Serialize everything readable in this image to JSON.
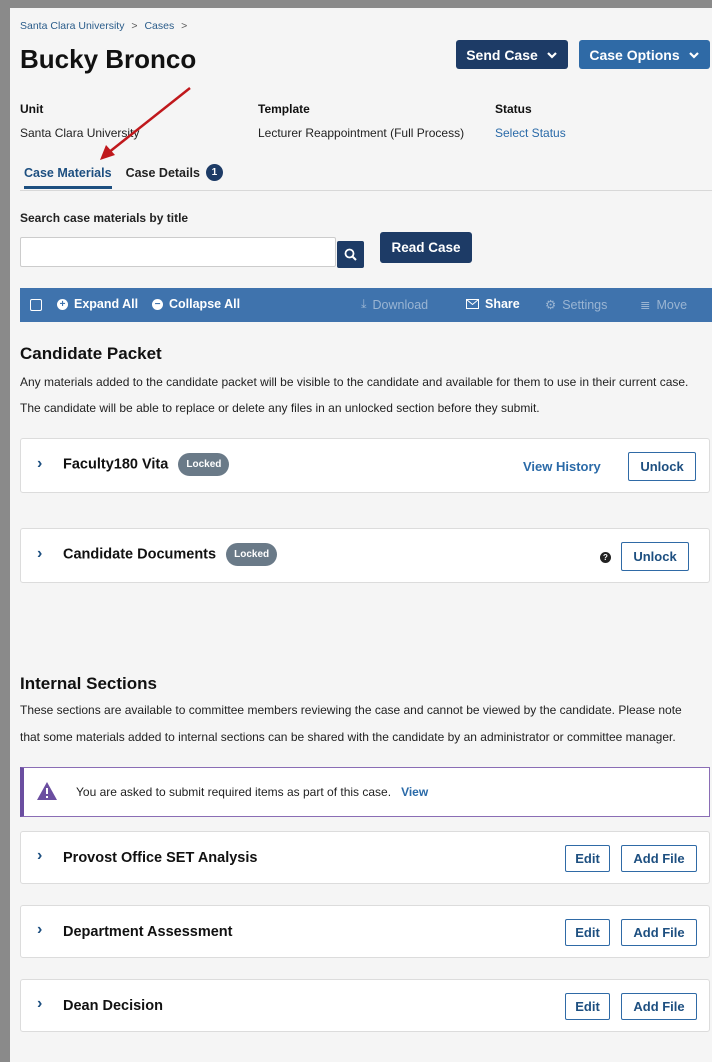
{
  "breadcrumb": {
    "item1": "Santa Clara University",
    "sep": ">",
    "item2": "Cases"
  },
  "title": "Bucky Bronco",
  "header_buttons": {
    "send_case": "Send Case",
    "case_options": "Case Options"
  },
  "meta": {
    "unit_label": "Unit",
    "unit_value": "Santa Clara University",
    "template_label": "Template",
    "template_value": "Lecturer Reappointment (Full Process)",
    "status_label": "Status",
    "status_value": "Select Status"
  },
  "tabs": {
    "materials": "Case Materials",
    "details": "Case Details",
    "details_count": "1"
  },
  "search": {
    "label": "Search case materials by title",
    "placeholder": "",
    "read_case": "Read Case"
  },
  "toolbar": {
    "expand_all": "Expand All",
    "collapse_all": "Collapse All",
    "download": "Download",
    "share": "Share",
    "settings": "Settings",
    "move": "Move"
  },
  "candidate_packet": {
    "title": "Candidate Packet",
    "line1": "Any materials added to the candidate packet will be visible to the candidate and available for them to use in their current case.",
    "line2": "The candidate will be able to replace or delete any files in an unlocked section before they submit.",
    "sections": [
      {
        "name": "Faculty180 Vita",
        "badge": "Locked",
        "history": "View History",
        "action": "Unlock"
      },
      {
        "name": "Candidate Documents",
        "badge": "Locked",
        "action": "Unlock"
      }
    ]
  },
  "internal": {
    "title": "Internal Sections",
    "line1": "These sections are available to committee members reviewing the case and cannot be viewed by the candidate. Please note",
    "line2": "that some materials added to internal sections can be shared with the candidate by an administrator or committee manager.",
    "alert_text": "You are asked to submit required items as part of this case.",
    "alert_view": "View",
    "sections": [
      {
        "name": "Provost Office SET Analysis",
        "edit": "Edit",
        "add": "Add File"
      },
      {
        "name": "Department Assessment",
        "edit": "Edit",
        "add": "Add File"
      },
      {
        "name": "Dean Decision",
        "edit": "Edit",
        "add": "Add File"
      }
    ]
  },
  "colors": {
    "navy": "#1d3b66",
    "toolbar": "#3f73ad",
    "accent_purple": "#6b4ea0",
    "arrow": "#c0181c"
  }
}
